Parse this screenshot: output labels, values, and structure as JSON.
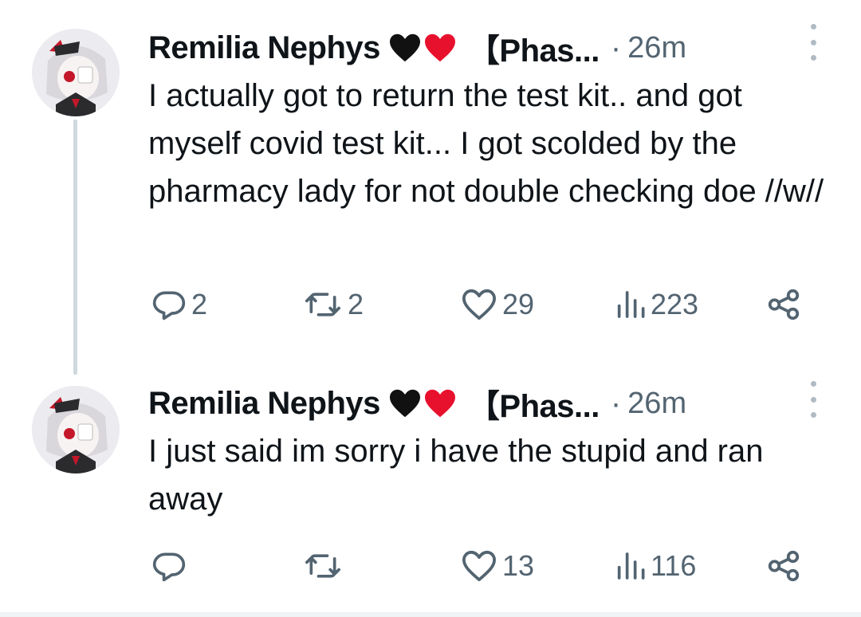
{
  "tweets": [
    {
      "author_name": "Remilia Nephys",
      "author_handle": "【Phas...",
      "separator": "·",
      "time": "26m",
      "text": "I actually got to return the test kit.. and got myself covid test kit... I got scolded by the pharmacy lady for not double checking doe //w//",
      "reply_count": "2",
      "retweet_count": "2",
      "like_count": "29",
      "view_count": "223"
    },
    {
      "author_name": "Remilia Nephys",
      "author_handle": "【Phas...",
      "separator": "·",
      "time": "26m",
      "text": "I just said im sorry i have the stupid and ran away",
      "reply_count": "",
      "retweet_count": "",
      "like_count": "13",
      "view_count": "116"
    }
  ],
  "icons": {
    "name_emojis": [
      "black-heart-icon",
      "red-heart-icon"
    ],
    "reply": "reply-bubble-icon",
    "retweet": "retweet-icon",
    "like": "heart-outline-icon",
    "views": "bar-chart-icon",
    "share": "share-icon",
    "more": "vertical-dots-icon"
  },
  "colors": {
    "text": "#0f1419",
    "secondary": "#536471",
    "thread_line": "#cfd9de",
    "red_heart": "#e8112d",
    "black_heart": "#111111"
  }
}
